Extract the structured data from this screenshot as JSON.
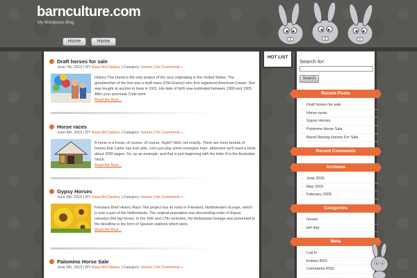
{
  "site": {
    "title": "barnculture.com",
    "description": "My Wordpress Blog"
  },
  "nav": {
    "items": [
      "Home",
      "Home"
    ]
  },
  "hotlist": {
    "label": "HOT LIST"
  },
  "posts": [
    {
      "title": "Draft horses for sale",
      "date": "June 7th, 2015",
      "by": "BY",
      "author": "Kiara McClaskey",
      "category_label": "Category:",
      "category": "horses",
      "separator": "|",
      "comments": "No Comments »",
      "excerpt": "History This breed is the only project of the race originating in the United States. The grandmother of the line was a draft mare (Old Granny) who first registered American Cream. She was bought at auction in Iowa in 1911. His date of birth was estimated between 1900 and 1905. After your purchase Colts went",
      "read_more": "Read the Rest..."
    },
    {
      "title": "Horse races",
      "date": "June 6th, 2015",
      "by": "BY",
      "author": "Kiara McClaskey",
      "category_label": "Category:",
      "category": "horses",
      "separator": "|",
      "comments": "No Comments »",
      "excerpt": "A horse is a horse, of course, of course. Right? Well, not exactly. There are more breeds of horses that Carter has liver pills. Let's just play some examples here, otherwise we'll need a book about 2000 pages. So, as an example, and that is just beginning with the letter A is the Australian Stock.",
      "read_more": "Read the Rest..."
    },
    {
      "title": "Gypsy Horses",
      "date": "June 5th, 2015",
      "by": "BY",
      "author": "Kiara McClaskey",
      "category_label": "Category:",
      "category": "horses",
      "separator": "|",
      "comments": "No Comments »",
      "excerpt": "Friesians Brief History Race This project has its roots in Friesland, Northwestern Europe, which is now a part of the Netherlands. The original population was descending order of Equus robustus (the big horse). In the 16th and 17th centuries, the Andalusian lineage was presented to the bloodline in the form of Spanish stallions which were",
      "read_more": "Read the Rest..."
    },
    {
      "title": "Palomino Horse Sale",
      "date": "June 5th, 2015",
      "by": "BY",
      "author": "Kiara McClaskey",
      "category_label": "Category:",
      "category": "horses",
      "separator": "|",
      "comments": "No Comments »",
      "excerpt": "",
      "read_more": ""
    }
  ],
  "sidebar": {
    "search_label": "Search for:",
    "search_value": "",
    "search_button": "Search",
    "recent_posts": {
      "heading": "Recent Posts",
      "items": [
        "Draft horses for sale",
        "Horse races",
        "Gypsy Horses",
        "Palomino Horse Sale",
        "Barrel Racing Horses For Sale"
      ]
    },
    "recent_comments": {
      "heading": "Recent Comments"
    },
    "archives": {
      "heading": "Archives",
      "items": [
        "June 2015",
        "May 2015",
        "February 2009"
      ]
    },
    "categories": {
      "heading": "Categories",
      "items": [
        "horses",
        "pet dog"
      ]
    },
    "meta": {
      "heading": "Meta",
      "items": [
        "Log in",
        "Entries RSS",
        "Comments RSS"
      ]
    }
  },
  "colors": {
    "accent": "#ea6b3a",
    "link": "#d0581e",
    "background": "#5a5854"
  }
}
